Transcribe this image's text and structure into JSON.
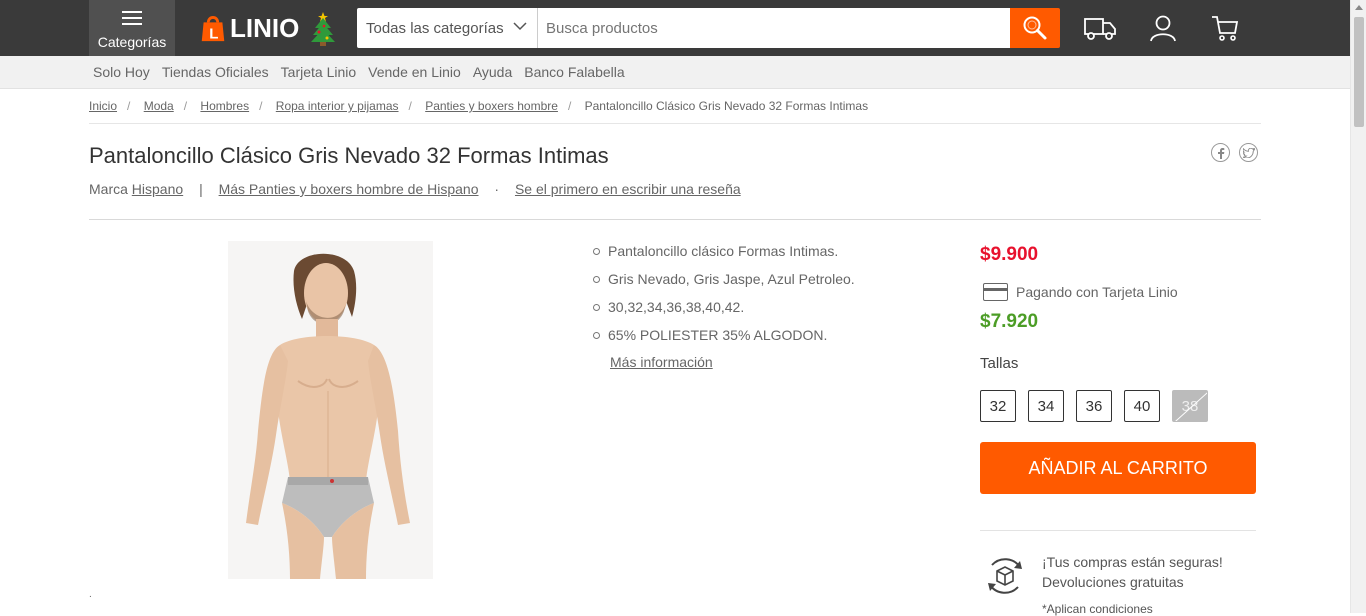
{
  "header": {
    "categories_label": "Categorías",
    "logo_text": "LINIO",
    "search": {
      "department": "Todas las categorías",
      "placeholder": "Busca productos"
    }
  },
  "subnav": [
    "Solo Hoy",
    "Tiendas Oficiales",
    "Tarjeta Linio",
    "Vende en Linio",
    "Ayuda",
    "Banco Falabella"
  ],
  "breadcrumb": {
    "links": [
      "Inicio",
      "Moda",
      "Hombres",
      "Ropa interior y pijamas",
      "Panties y boxers hombre"
    ],
    "current": "Pantaloncillo Clásico Gris Nevado 32 Formas Intimas"
  },
  "product": {
    "title": "Pantaloncillo Clásico Gris Nevado 32 Formas Intimas",
    "brand_prefix": "Marca",
    "brand": "Hispano",
    "pipe": "|",
    "more_link": "Más Panties y boxers hombre de Hispano",
    "dot": "·",
    "review_link": "Se el primero en escribir una reseña",
    "bullets": [
      "Pantaloncillo clásico Formas Intimas.",
      "Gris Nevado, Gris Jaspe, Azul Petroleo.",
      "30,32,34,36,38,40,42.",
      "65% POLIESTER 35% ALGODON."
    ],
    "more_info": "Más información",
    "price": "$9.900",
    "card_text": "Pagando con Tarjeta Linio",
    "price_card": "$7.920",
    "sizes_label": "Tallas",
    "sizes": [
      "32",
      "34",
      "36",
      "40",
      "38"
    ],
    "add_to_cart": "AÑADIR AL CARRITO",
    "secure_line1": "¡Tus compras están seguras!",
    "secure_line2": "Devoluciones gratuitas",
    "conditions": "*Aplican condiciones",
    "tiny_dot": "."
  },
  "colors": {
    "header_bg": "#3a3a3a",
    "accent": "#ff5a00",
    "price_red": "#e8112d",
    "price_green": "#4c9d26"
  }
}
